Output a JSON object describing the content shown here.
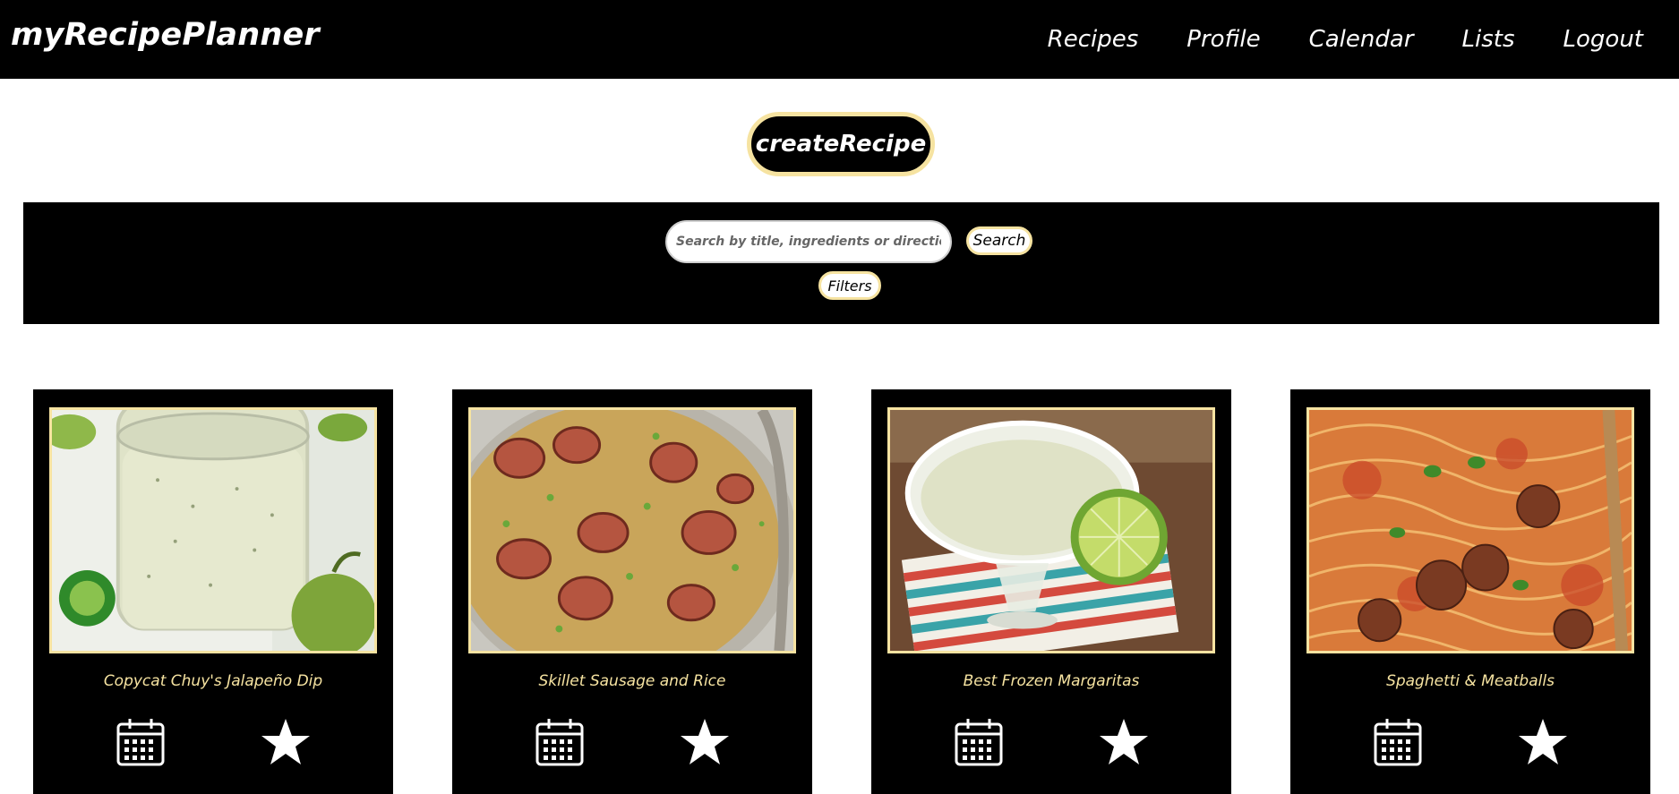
{
  "header": {
    "brand": "myRecipePlanner",
    "nav": [
      "Recipes",
      "Profile",
      "Calendar",
      "Lists",
      "Logout"
    ]
  },
  "create_button": "createRecipe",
  "search": {
    "placeholder": "Search by title, ingredients or directions",
    "button_label": "Search",
    "filters_label": "Filters"
  },
  "recipes": [
    {
      "title": "Copycat Chuy's Jalapeño Dip",
      "image": "jalapeno-dip-photo"
    },
    {
      "title": "Skillet Sausage and Rice",
      "image": "sausage-rice-photo"
    },
    {
      "title": "Best Frozen Margaritas",
      "image": "margarita-photo"
    },
    {
      "title": "Spaghetti & Meatballs",
      "image": "spaghetti-photo"
    }
  ],
  "colors": {
    "bar": "#000000",
    "accent": "#f6e3a1",
    "text_light": "#ffffff"
  },
  "icons": {
    "calendar": "calendar-icon",
    "favorite": "star-icon"
  }
}
